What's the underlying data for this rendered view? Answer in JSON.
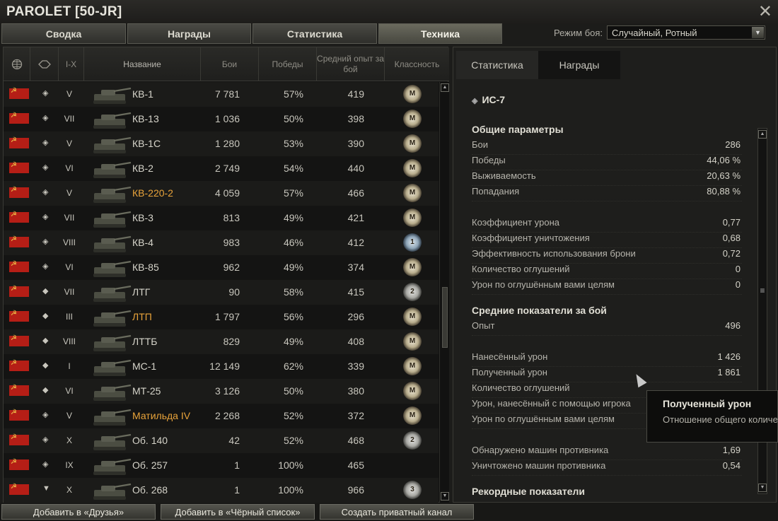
{
  "window": {
    "title": "PAROLET [50-JR]",
    "close_icon": "close-icon"
  },
  "tabs": [
    {
      "label": "Сводка"
    },
    {
      "label": "Награды"
    },
    {
      "label": "Статистика"
    },
    {
      "label": "Техника",
      "active": true
    }
  ],
  "battle_mode": {
    "label": "Режим боя:",
    "value": "Случайный, Ротный"
  },
  "table": {
    "columns": {
      "nation": "nation-globe-icon",
      "type": "vehicle-type-icon",
      "tier": "I-X",
      "name": "Название",
      "battles": "Бои",
      "wins": "Победы",
      "avg_xp": "Средний опыт за бой",
      "mastery": "Классность"
    },
    "rows": [
      {
        "tier": "V",
        "name": "КВ-1",
        "battles": "7 781",
        "wins": "57%",
        "xp": "419",
        "badge": "M",
        "type_icon": "heavy-tank-icon",
        "highlight": false
      },
      {
        "tier": "VII",
        "name": "КВ-13",
        "battles": "1 036",
        "wins": "50%",
        "xp": "398",
        "badge": "M",
        "type_icon": "medium-tank-icon",
        "highlight": false
      },
      {
        "tier": "V",
        "name": "КВ-1С",
        "battles": "1 280",
        "wins": "53%",
        "xp": "390",
        "badge": "M",
        "type_icon": "heavy-tank-icon",
        "highlight": false
      },
      {
        "tier": "VI",
        "name": "КВ-2",
        "battles": "2 749",
        "wins": "54%",
        "xp": "440",
        "badge": "M",
        "type_icon": "heavy-tank-icon",
        "highlight": false
      },
      {
        "tier": "V",
        "name": "КВ-220-2",
        "battles": "4 059",
        "wins": "57%",
        "xp": "466",
        "badge": "M",
        "type_icon": "heavy-tank-icon",
        "highlight": true
      },
      {
        "tier": "VII",
        "name": "КВ-3",
        "battles": "813",
        "wins": "49%",
        "xp": "421",
        "badge": "M",
        "type_icon": "heavy-tank-icon",
        "highlight": false
      },
      {
        "tier": "VIII",
        "name": "КВ-4",
        "battles": "983",
        "wins": "46%",
        "xp": "412",
        "badge": "1",
        "type_icon": "heavy-tank-icon",
        "highlight": false
      },
      {
        "tier": "VI",
        "name": "КВ-85",
        "battles": "962",
        "wins": "49%",
        "xp": "374",
        "badge": "M",
        "type_icon": "heavy-tank-icon",
        "highlight": false
      },
      {
        "tier": "VII",
        "name": "ЛТГ",
        "battles": "90",
        "wins": "58%",
        "xp": "415",
        "badge": "2",
        "type_icon": "light-tank-icon",
        "highlight": false
      },
      {
        "tier": "III",
        "name": "ЛТП",
        "battles": "1 797",
        "wins": "56%",
        "xp": "296",
        "badge": "M",
        "type_icon": "light-tank-icon",
        "highlight": true
      },
      {
        "tier": "VIII",
        "name": "ЛТТБ",
        "battles": "829",
        "wins": "49%",
        "xp": "408",
        "badge": "M",
        "type_icon": "light-tank-icon",
        "highlight": false
      },
      {
        "tier": "I",
        "name": "МС-1",
        "battles": "12 149",
        "wins": "62%",
        "xp": "339",
        "badge": "M",
        "type_icon": "light-tank-icon",
        "highlight": false
      },
      {
        "tier": "VI",
        "name": "МТ-25",
        "battles": "3 126",
        "wins": "50%",
        "xp": "380",
        "badge": "M",
        "type_icon": "light-tank-icon",
        "highlight": false
      },
      {
        "tier": "V",
        "name": "Матильда IV",
        "battles": "2 268",
        "wins": "52%",
        "xp": "372",
        "badge": "M",
        "type_icon": "medium-tank-icon",
        "highlight": true
      },
      {
        "tier": "X",
        "name": "Об. 140",
        "battles": "42",
        "wins": "52%",
        "xp": "468",
        "badge": "2",
        "type_icon": "medium-tank-icon",
        "highlight": false
      },
      {
        "tier": "IX",
        "name": "Об. 257",
        "battles": "1",
        "wins": "100%",
        "xp": "465",
        "badge": "",
        "type_icon": "heavy-tank-icon",
        "highlight": false
      },
      {
        "tier": "X",
        "name": "Об. 268",
        "battles": "1",
        "wins": "100%",
        "xp": "966",
        "badge": "3",
        "type_icon": "tank-destroyer-icon",
        "highlight": false
      }
    ]
  },
  "detail": {
    "tabs": [
      "Статистика",
      "Награды"
    ],
    "vehicle_name": "ИС-7",
    "general_title": "Общие параметры",
    "general": [
      {
        "label": "Бои",
        "value": "286"
      },
      {
        "label": "Победы",
        "value": "44,06 %"
      },
      {
        "label": "Выживаемость",
        "value": "20,63 %"
      },
      {
        "label": "Попадания",
        "value": "80,88 %"
      }
    ],
    "coefficients": [
      {
        "label": "Коэффициент урона",
        "value": "0,77"
      },
      {
        "label": "Коэффициент уничтожения",
        "value": "0,68"
      },
      {
        "label": "Эффективность использования брони",
        "value": "0,72"
      },
      {
        "label": "Количество оглушений",
        "value": "0"
      },
      {
        "label": "Урон по оглушённым вами целям",
        "value": "0"
      }
    ],
    "avg_title": "Средние показатели за бой",
    "avg_xp": {
      "label": "Опыт",
      "value": "496"
    },
    "avg_damage": [
      {
        "label": "Нанесённый урон",
        "value": "1 426"
      },
      {
        "label": "Полученный урон",
        "value": "1 861"
      },
      {
        "label": "Количество оглушений",
        "value": ""
      },
      {
        "label": "Урон, нанесённый с помощью игрока",
        "value": ""
      },
      {
        "label": "Урон по оглушённым вами целям",
        "value": ""
      }
    ],
    "avg_spotting": [
      {
        "label": "Обнаружено машин противника",
        "value": "1,69"
      },
      {
        "label": "Уничтожено машин противника",
        "value": "0,54"
      }
    ],
    "records_title": "Рекордные показатели"
  },
  "tooltip": {
    "title": "Полученный урон",
    "text": "Отношение общего количес"
  },
  "buttons": {
    "add_friend": "Добавить в «Друзья»",
    "add_blacklist": "Добавить в «Чёрный список»",
    "private_channel": "Создать приватный канал"
  }
}
